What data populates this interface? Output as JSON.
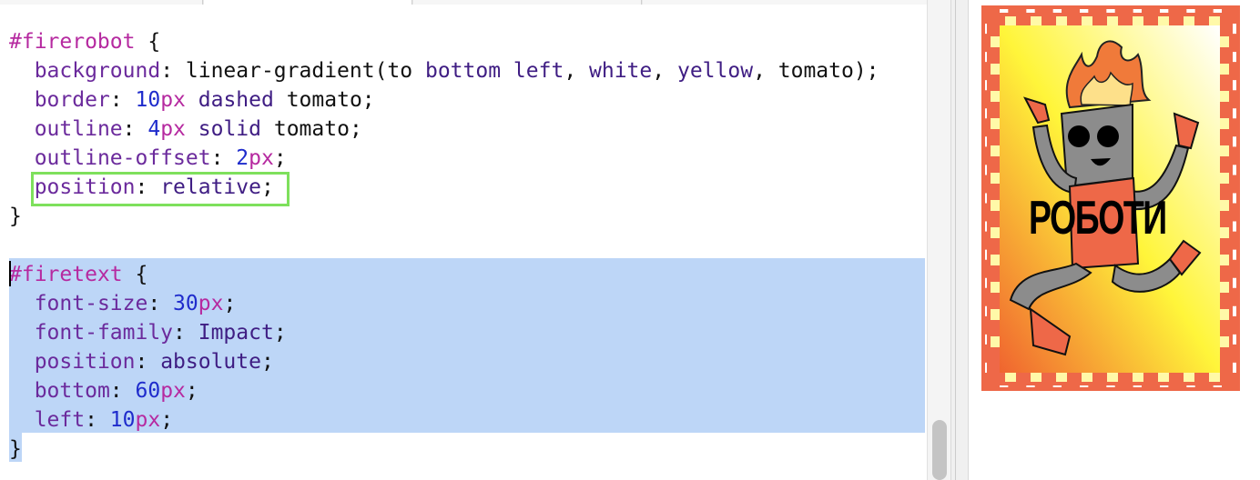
{
  "code_lines": [
    {
      "parts": [
        {
          "c": "sel",
          "t": "#firerobot"
        },
        {
          "c": "plain",
          "t": " {"
        }
      ]
    },
    {
      "parts": [
        {
          "c": "plain",
          "t": "  "
        },
        {
          "c": "prop",
          "t": "background"
        },
        {
          "c": "plain",
          "t": ": linear-gradient(to "
        },
        {
          "c": "kw",
          "t": "bottom left"
        },
        {
          "c": "plain",
          "t": ", "
        },
        {
          "c": "kw",
          "t": "white"
        },
        {
          "c": "plain",
          "t": ", "
        },
        {
          "c": "kw",
          "t": "yellow"
        },
        {
          "c": "plain",
          "t": ", tomato);"
        }
      ]
    },
    {
      "parts": [
        {
          "c": "plain",
          "t": "  "
        },
        {
          "c": "prop",
          "t": "border"
        },
        {
          "c": "plain",
          "t": ": "
        },
        {
          "c": "num",
          "t": "10"
        },
        {
          "c": "unit",
          "t": "px"
        },
        {
          "c": "plain",
          "t": " "
        },
        {
          "c": "kw",
          "t": "dashed"
        },
        {
          "c": "plain",
          "t": " tomato;"
        }
      ]
    },
    {
      "parts": [
        {
          "c": "plain",
          "t": "  "
        },
        {
          "c": "prop",
          "t": "outline"
        },
        {
          "c": "plain",
          "t": ": "
        },
        {
          "c": "num",
          "t": "4"
        },
        {
          "c": "unit",
          "t": "px"
        },
        {
          "c": "plain",
          "t": " "
        },
        {
          "c": "kw",
          "t": "solid"
        },
        {
          "c": "plain",
          "t": " tomato;"
        }
      ]
    },
    {
      "parts": [
        {
          "c": "plain",
          "t": "  "
        },
        {
          "c": "prop",
          "t": "outline-offset"
        },
        {
          "c": "plain",
          "t": ": "
        },
        {
          "c": "num",
          "t": "2"
        },
        {
          "c": "unit",
          "t": "px"
        },
        {
          "c": "plain",
          "t": ";"
        }
      ]
    },
    {
      "parts": [
        {
          "c": "plain",
          "t": "  "
        },
        {
          "c": "prop",
          "t": "position"
        },
        {
          "c": "plain",
          "t": ": "
        },
        {
          "c": "kw",
          "t": "relative"
        },
        {
          "c": "plain",
          "t": ";"
        }
      ]
    },
    {
      "parts": [
        {
          "c": "plain",
          "t": "}"
        }
      ]
    },
    {
      "parts": [
        {
          "c": "plain",
          "t": ""
        }
      ]
    },
    {
      "parts": [
        {
          "c": "sel",
          "t": "#firetext"
        },
        {
          "c": "plain",
          "t": " {"
        }
      ]
    },
    {
      "parts": [
        {
          "c": "plain",
          "t": "  "
        },
        {
          "c": "prop",
          "t": "font-size"
        },
        {
          "c": "plain",
          "t": ": "
        },
        {
          "c": "num",
          "t": "30"
        },
        {
          "c": "unit",
          "t": "px"
        },
        {
          "c": "plain",
          "t": ";"
        }
      ]
    },
    {
      "parts": [
        {
          "c": "plain",
          "t": "  "
        },
        {
          "c": "prop",
          "t": "font-family"
        },
        {
          "c": "plain",
          "t": ": "
        },
        {
          "c": "kw",
          "t": "Impact"
        },
        {
          "c": "plain",
          "t": ";"
        }
      ]
    },
    {
      "parts": [
        {
          "c": "plain",
          "t": "  "
        },
        {
          "c": "prop",
          "t": "position"
        },
        {
          "c": "plain",
          "t": ": "
        },
        {
          "c": "kw",
          "t": "absolute"
        },
        {
          "c": "plain",
          "t": ";"
        }
      ]
    },
    {
      "parts": [
        {
          "c": "plain",
          "t": "  "
        },
        {
          "c": "prop",
          "t": "bottom"
        },
        {
          "c": "plain",
          "t": ": "
        },
        {
          "c": "num",
          "t": "60"
        },
        {
          "c": "unit",
          "t": "px"
        },
        {
          "c": "plain",
          "t": ";"
        }
      ]
    },
    {
      "parts": [
        {
          "c": "plain",
          "t": "  "
        },
        {
          "c": "prop",
          "t": "left"
        },
        {
          "c": "plain",
          "t": ": "
        },
        {
          "c": "num",
          "t": "10"
        },
        {
          "c": "unit",
          "t": "px"
        },
        {
          "c": "plain",
          "t": ";"
        }
      ]
    },
    {
      "parts": [
        {
          "c": "plain",
          "t": "}"
        }
      ]
    }
  ],
  "preview": {
    "fire_text": "РОБОТИ",
    "colors": {
      "tomato": "#ee6848",
      "yellow": "#fff53a",
      "highlight_border": "#7ee05c",
      "selection": "#bdd6f7"
    },
    "image_icon": "fire-robot-illustration"
  }
}
